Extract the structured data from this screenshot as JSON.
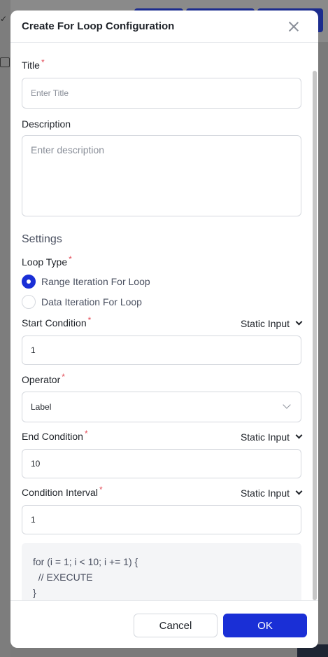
{
  "modal": {
    "title": "Create For Loop Configuration"
  },
  "fields": {
    "title": {
      "label": "Title",
      "required": "*",
      "placeholder": "Enter Title"
    },
    "description": {
      "label": "Description",
      "placeholder": "Enter description"
    }
  },
  "settings": {
    "heading": "Settings",
    "loop_type": {
      "label": "Loop Type",
      "required": "*",
      "options": [
        {
          "label": "Range Iteration For Loop",
          "selected": true
        },
        {
          "label": "Data Iteration For Loop",
          "selected": false
        }
      ]
    },
    "start_condition": {
      "label": "Start Condition",
      "required": "*",
      "mode": "Static Input",
      "value": "1"
    },
    "operator": {
      "label": "Operator",
      "required": "*",
      "value": "Label"
    },
    "end_condition": {
      "label": "End Condition",
      "required": "*",
      "mode": "Static Input",
      "value": "10"
    },
    "condition_interval": {
      "label": "Condition Interval",
      "required": "*",
      "mode": "Static Input",
      "value": "1"
    }
  },
  "code_preview": {
    "line1": "for (i = 1; i < 10; i += 1) {",
    "line2": "  // EXECUTE",
    "line3": "}"
  },
  "footer": {
    "cancel_label": "Cancel",
    "ok_label": "OK"
  },
  "colors": {
    "primary": "#1a2fd6",
    "required": "#e34d59",
    "border": "#d5d8de"
  }
}
